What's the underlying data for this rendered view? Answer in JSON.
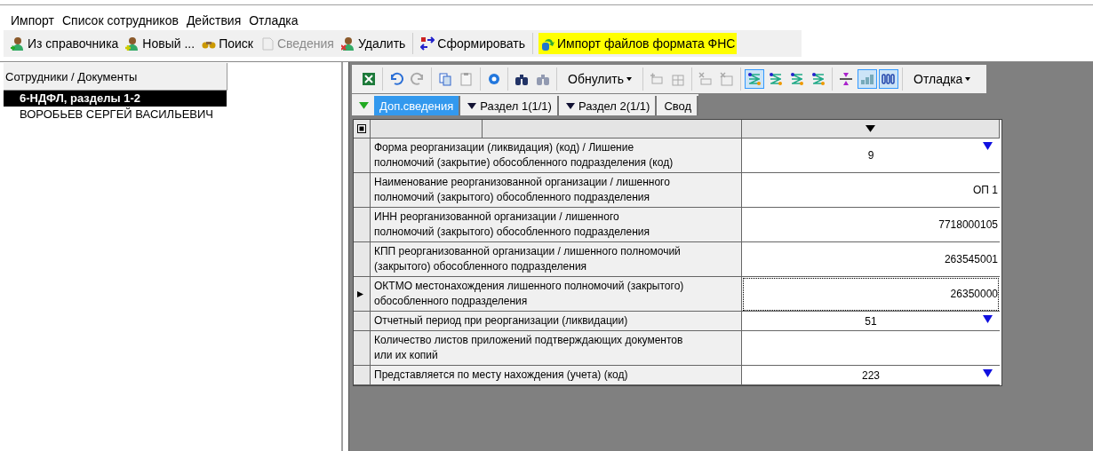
{
  "menu": [
    "Импорт",
    "Список сотрудников",
    "Действия",
    "Отладка"
  ],
  "toolbar": [
    [
      {
        "label": "Из справочника",
        "disabled": false,
        "highlighted": false
      },
      {
        "label": "Новый ...",
        "disabled": false,
        "highlighted": false
      },
      {
        "label": "Поиск",
        "disabled": false,
        "highlighted": false
      },
      {
        "label": "Сведения",
        "disabled": true,
        "highlighted": false
      },
      {
        "label": "Удалить",
        "disabled": false,
        "highlighted": false
      }
    ],
    [
      {
        "label": "Сформировать",
        "disabled": false,
        "highlighted": false
      }
    ],
    [
      {
        "label": "Импорт файлов формата ФНС",
        "disabled": false,
        "highlighted": true
      }
    ]
  ],
  "tree": {
    "header": "Сотрудники / Документы",
    "items": [
      {
        "label": "6-НДФЛ, разделы 1-2",
        "selected": true
      },
      {
        "label": "ВОРОБЬЕВ СЕРГЕЙ ВАСИЛЬЕВИЧ",
        "selected": false
      }
    ]
  },
  "grid_toolbar": [
    [
      {
        "kind": "icon",
        "disabled": false,
        "pressed": false
      }
    ],
    [
      {
        "kind": "icon",
        "disabled": false,
        "pressed": false
      },
      {
        "kind": "icon",
        "disabled": true,
        "pressed": false
      }
    ],
    [
      {
        "kind": "icon",
        "disabled": false,
        "pressed": false
      },
      {
        "kind": "icon",
        "disabled": true,
        "pressed": false
      }
    ],
    [
      {
        "kind": "icon",
        "disabled": false,
        "pressed": false
      }
    ],
    [
      {
        "kind": "icon",
        "disabled": false,
        "pressed": false
      },
      {
        "kind": "icon",
        "disabled": true,
        "pressed": false
      }
    ],
    [
      {
        "kind": "menu",
        "label": "Обнулить"
      }
    ],
    [
      {
        "kind": "icon",
        "disabled": true,
        "pressed": false
      },
      {
        "kind": "icon",
        "disabled": true,
        "pressed": false
      }
    ],
    [
      {
        "kind": "icon",
        "disabled": true,
        "pressed": false
      },
      {
        "kind": "icon",
        "disabled": true,
        "pressed": false
      }
    ],
    [
      {
        "kind": "icon",
        "disabled": false,
        "pressed": true
      },
      {
        "kind": "icon",
        "disabled": false,
        "pressed": false
      },
      {
        "kind": "icon",
        "disabled": false,
        "pressed": false
      },
      {
        "kind": "icon",
        "disabled": false,
        "pressed": false
      }
    ],
    [
      {
        "kind": "icon",
        "disabled": false,
        "pressed": false
      },
      {
        "kind": "icon",
        "disabled": false,
        "pressed": true
      },
      {
        "kind": "icon",
        "disabled": false,
        "pressed": true
      }
    ],
    [
      {
        "kind": "menu",
        "label": "Отладка"
      }
    ]
  ],
  "tabs": [
    {
      "label": "Доп.сведения",
      "selected": true,
      "marker": false
    },
    {
      "label": "Раздел 1(1/1)",
      "selected": false,
      "marker": true
    },
    {
      "label": "Раздел 2(1/1)",
      "selected": false,
      "marker": true
    },
    {
      "label": "Свод",
      "selected": false,
      "marker": false
    }
  ],
  "grid": {
    "rows": [
      {
        "label": "Форма реорганизации (ликвидация) (код) / Лишение\nполномочий (закрытие) обособленного подразделения (код)",
        "value": "9",
        "kind": "dropdown",
        "current": false
      },
      {
        "label": "Наименование реорганизованной организации / лишенного\nполномочий (закрытого) обособленного подразделения",
        "value": "ОП 1",
        "kind": "text",
        "current": false
      },
      {
        "label": "ИНН реорганизованной организации / лишенного\nполномочий (закрытого) обособленного подразделения",
        "value": "7718000105",
        "kind": "text",
        "current": false
      },
      {
        "label": "КПП реорганизованной организации / лишенного полномочий\n(закрытого) обособленного подразделения",
        "value": "263545001",
        "kind": "text",
        "current": false
      },
      {
        "label": "ОКТМО местонахождения лишенного полномочий (закрытого)\nобособленного подразделения",
        "value": "26350000",
        "kind": "text",
        "current": true
      },
      {
        "label": "Отчетный период при реорганизации (ликвидации)",
        "value": "51",
        "kind": "dropdown",
        "current": false
      },
      {
        "label": "Количество листов приложений подтверждающих документов\nили их копий",
        "kind": "text",
        "current": false
      },
      {
        "label": "Представляется по месту нахождения (учета) (код)",
        "value": "223",
        "kind": "dropdown",
        "current": false
      }
    ]
  }
}
